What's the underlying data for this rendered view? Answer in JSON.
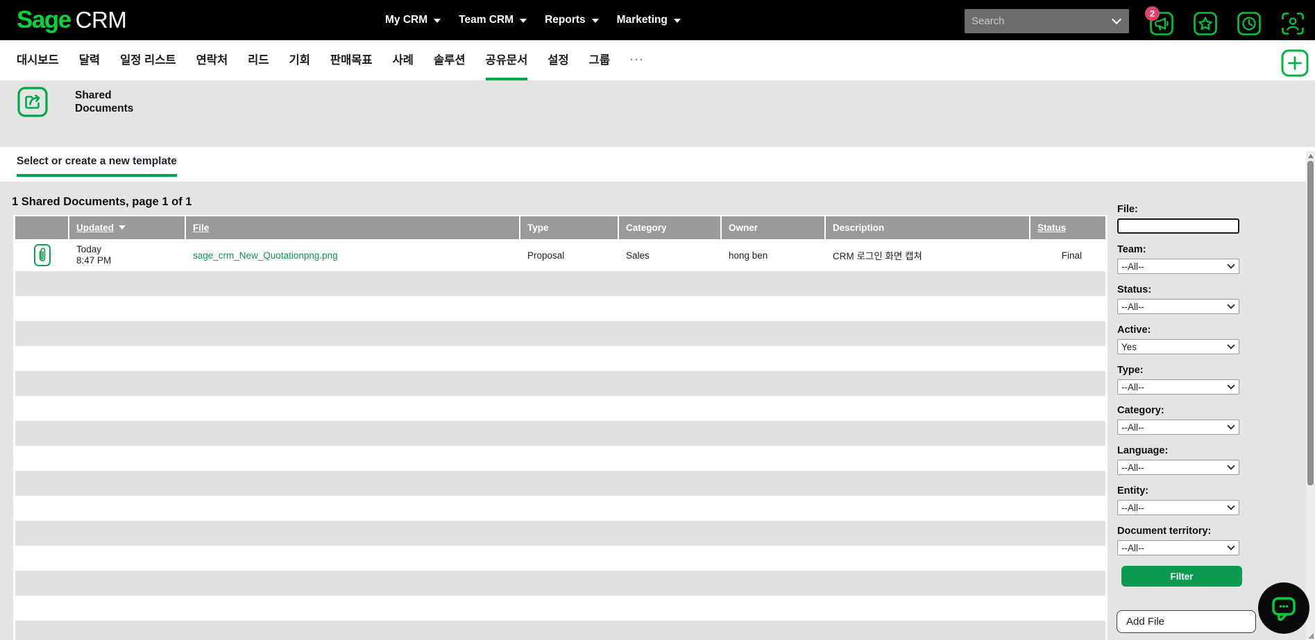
{
  "topbar": {
    "logo": {
      "brand": "Sage",
      "product": "CRM"
    },
    "nav": [
      {
        "label": "My CRM"
      },
      {
        "label": "Team CRM"
      },
      {
        "label": "Reports"
      },
      {
        "label": "Marketing"
      }
    ],
    "search": {
      "placeholder": "Search",
      "value": ""
    },
    "icons": [
      {
        "name": "announcements-megaphone",
        "badge": "2"
      },
      {
        "name": "favorites-star"
      },
      {
        "name": "recent-clock"
      },
      {
        "name": "profile-person"
      }
    ]
  },
  "tabbar": {
    "tabs": [
      {
        "label": "대시보드"
      },
      {
        "label": "달력"
      },
      {
        "label": "일정 리스트"
      },
      {
        "label": "연락처"
      },
      {
        "label": "리드"
      },
      {
        "label": "기회"
      },
      {
        "label": "판매목표"
      },
      {
        "label": "사례"
      },
      {
        "label": "솔루션"
      },
      {
        "label": "공유문서",
        "active": true
      },
      {
        "label": "설정"
      },
      {
        "label": "그룹"
      },
      {
        "label": "···",
        "more": true
      }
    ]
  },
  "page_header": {
    "title_line1": "Shared",
    "title_line2": "Documents"
  },
  "template_bar": {
    "tab_label": "Select or create a new template"
  },
  "grid": {
    "summary": "1 Shared Documents, page 1 of 1",
    "columns": [
      {
        "label": ""
      },
      {
        "label": "Updated",
        "sorted_desc": true
      },
      {
        "label": "File"
      },
      {
        "label": "Type"
      },
      {
        "label": "Category"
      },
      {
        "label": "Owner"
      },
      {
        "label": "Description"
      },
      {
        "label": "Status"
      }
    ],
    "rows": [
      {
        "updated_line1": "Today",
        "updated_line2": "8:47 PM",
        "file": "sage_crm_New_Quotationpng.png",
        "type": "Proposal",
        "category": "Sales",
        "owner": "hong ben",
        "description": "CRM 로그인 화면 캡쳐",
        "status": "Final"
      }
    ]
  },
  "filters": {
    "file": {
      "label": "File:",
      "value": ""
    },
    "fields": [
      {
        "label": "Team:",
        "value": "--All--"
      },
      {
        "label": "Status:",
        "value": "--All--"
      },
      {
        "label": "Active:",
        "value": "Yes"
      },
      {
        "label": "Type:",
        "value": "--All--"
      },
      {
        "label": "Category:",
        "value": "--All--"
      },
      {
        "label": "Language:",
        "value": "--All--"
      },
      {
        "label": "Entity:",
        "value": "--All--"
      },
      {
        "label": "Document territory:",
        "value": "--All--"
      }
    ],
    "filter_button": "Filter",
    "add_file_button": "Add File"
  },
  "colors": {
    "brand_green": "#00d639",
    "icon_green": "#00c83e",
    "accent_green": "#00a651",
    "link_green": "#12954a",
    "button_green": "#0a9b51",
    "badge_red": "#e0436a",
    "topbar_black": "#000000",
    "grid_header_gray": "#9a9a9a",
    "stripe_gray": "#e1e1e1",
    "page_gray": "#e4e4e4",
    "search_gray": "#6d6d6d"
  }
}
